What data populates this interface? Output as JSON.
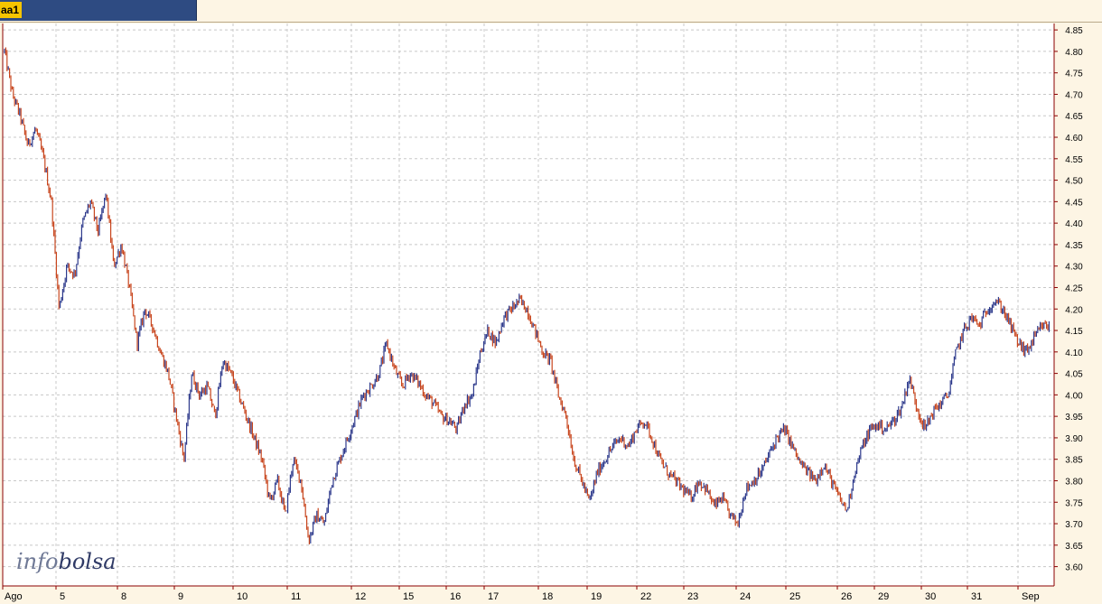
{
  "tab": {
    "label": "aa1"
  },
  "logo": {
    "part1": "info",
    "part2": "bolsa"
  },
  "colors": {
    "background": "#ffffff",
    "grid": "#c8c8c8",
    "up": "#2e3a8c",
    "down": "#c8461e",
    "axis": "#8b0000"
  },
  "chart_data": {
    "type": "line",
    "title": "",
    "xlabel": "",
    "ylabel": "",
    "ylim": [
      3.555,
      4.865
    ],
    "y_ticks": [
      3.6,
      3.65,
      3.7,
      3.75,
      3.8,
      3.85,
      3.9,
      3.95,
      4.0,
      4.05,
      4.1,
      4.15,
      4.2,
      4.25,
      4.3,
      4.35,
      4.4,
      4.45,
      4.5,
      4.55,
      4.6,
      4.65,
      4.7,
      4.75,
      4.8,
      4.85
    ],
    "y_axis_position": "right",
    "grid": true,
    "categories": [
      "Ago",
      "5",
      "8",
      "9",
      "10",
      "11",
      "12",
      "15",
      "16",
      "17",
      "18",
      "19",
      "22",
      "23",
      "24",
      "25",
      "26",
      "29",
      "30",
      "31",
      "Sep"
    ],
    "series": [
      {
        "values": [
          4.8,
          4.7,
          4.65,
          4.58,
          4.62,
          4.55,
          4.45,
          4.2,
          4.3,
          4.28,
          4.4,
          4.45,
          4.38,
          4.47,
          4.3,
          4.35,
          4.25,
          4.12,
          4.2,
          4.16,
          4.1,
          4.05,
          3.95,
          3.85,
          4.05,
          4.0,
          4.02,
          3.95,
          4.08,
          4.05,
          4.0,
          3.95,
          3.9,
          3.85,
          3.75,
          3.8,
          3.72,
          3.85,
          3.8,
          3.66,
          3.72,
          3.7,
          3.8,
          3.85,
          3.9,
          3.95,
          4.0,
          4.02,
          4.05,
          4.12,
          4.06,
          4.02,
          4.05,
          4.03,
          4.0,
          3.98,
          3.95,
          3.94,
          3.92,
          3.98,
          4.0,
          4.1,
          4.15,
          4.12,
          4.18,
          4.2,
          4.22,
          4.2,
          4.15,
          4.1,
          4.08,
          4.0,
          3.95,
          3.85,
          3.8,
          3.75,
          3.82,
          3.85,
          3.88,
          3.9,
          3.88,
          3.92,
          3.94,
          3.9,
          3.85,
          3.82,
          3.8,
          3.78,
          3.76,
          3.8,
          3.78,
          3.74,
          3.76,
          3.72,
          3.7,
          3.78,
          3.8,
          3.82,
          3.86,
          3.9,
          3.92,
          3.88,
          3.84,
          3.82,
          3.8,
          3.84,
          3.8,
          3.76,
          3.73,
          3.82,
          3.88,
          3.92,
          3.93,
          3.92,
          3.94,
          3.97,
          4.04,
          3.97,
          3.92,
          3.96,
          3.98,
          4.0,
          4.1,
          4.15,
          4.18,
          4.16,
          4.2,
          4.22,
          4.2,
          4.16,
          4.12,
          4.1,
          4.13,
          4.16,
          4.16
        ]
      }
    ]
  }
}
